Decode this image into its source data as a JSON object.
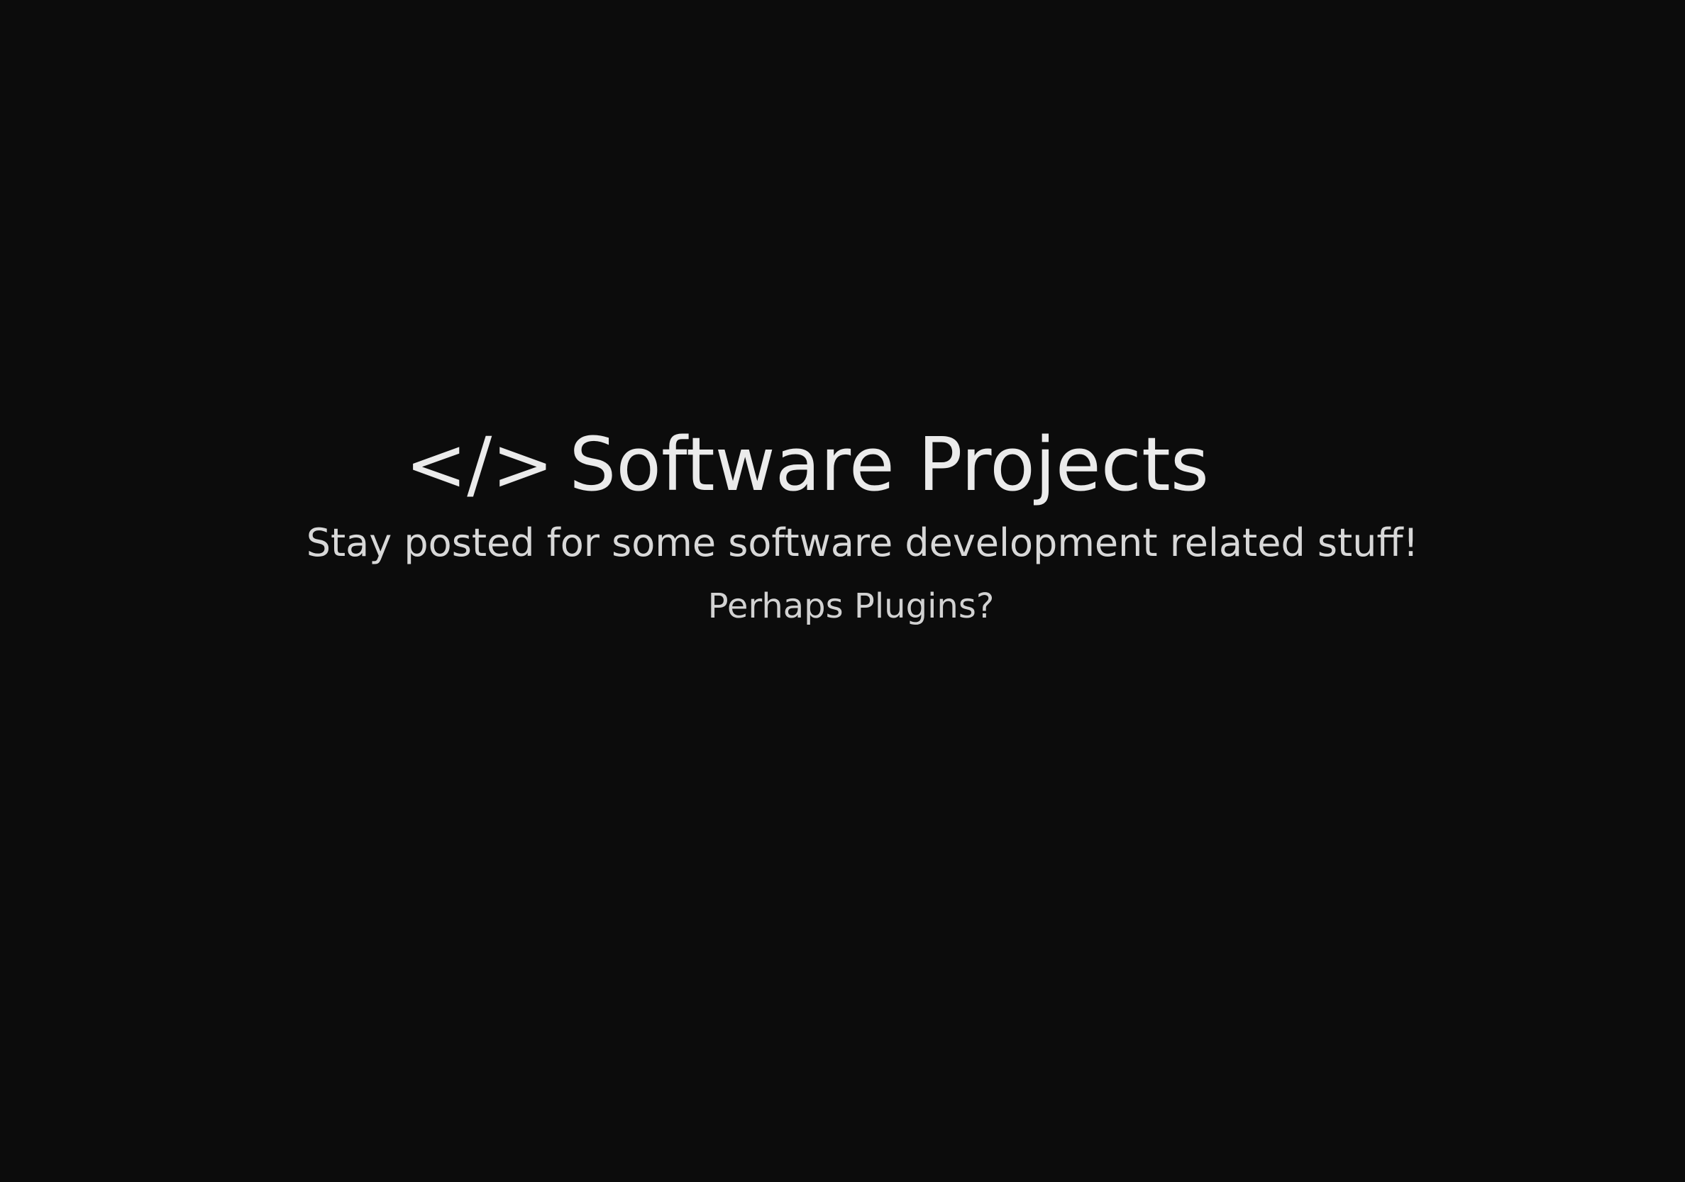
{
  "hero": {
    "icon": "code-icon",
    "icon_glyph": "</>",
    "title": "Software Projects",
    "subtitle": "Stay posted for some software development related stuff!",
    "note": "Perhaps Plugins?"
  },
  "colors": {
    "background": "#0c0c0c",
    "text": "#ebebeb"
  }
}
